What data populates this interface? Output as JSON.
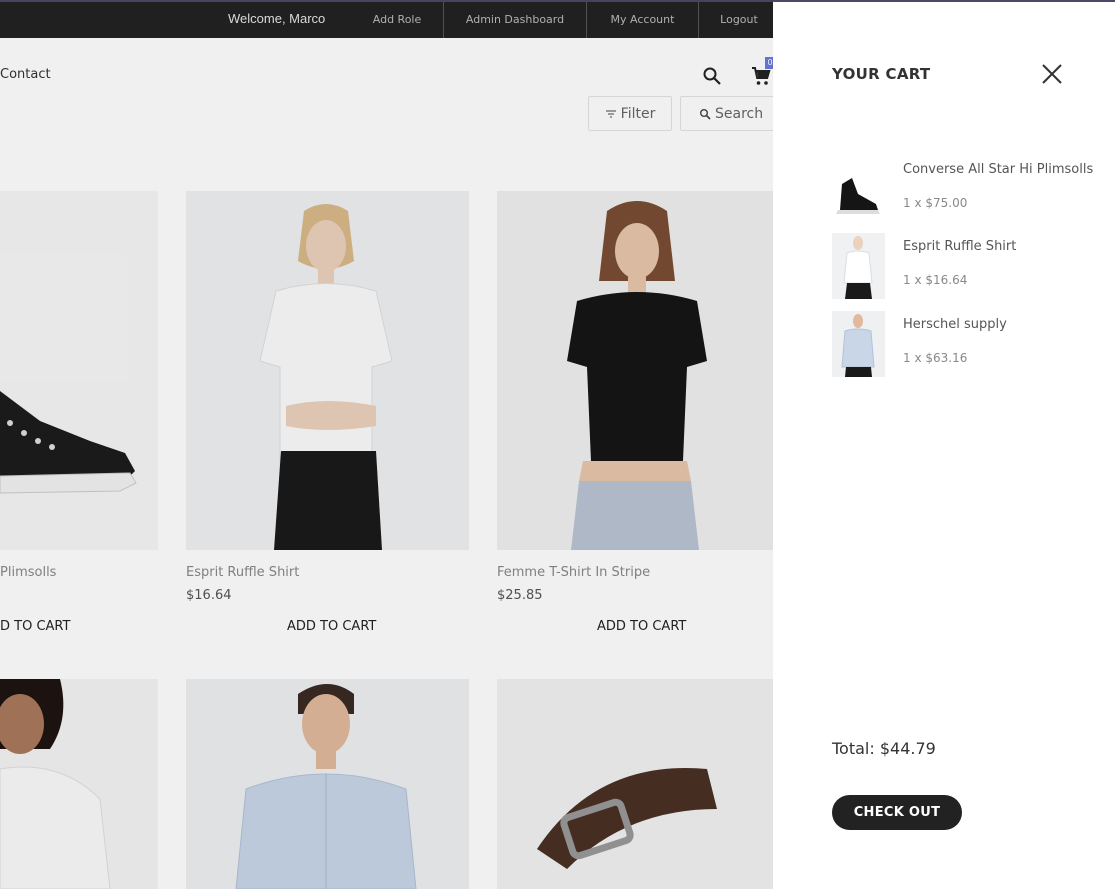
{
  "topbar": {
    "welcome": "Welcome, Marco",
    "links": [
      "Add Role",
      "Admin Dashboard",
      "My Account",
      "Logout"
    ]
  },
  "nav": {
    "contact": "Contact",
    "cart_count": "0"
  },
  "toolbar": {
    "filter_label": "Filter",
    "search_label": "Search"
  },
  "products": [
    {
      "name": "Converse All Star Hi Plimsolls",
      "visible_name": "Plimsolls",
      "price": "",
      "add_label": "ADD TO CART",
      "visible_add": "D TO CART"
    },
    {
      "name": "Esprit Ruffle Shirt",
      "price": "$16.64",
      "add_label": "ADD TO CART"
    },
    {
      "name": "Femme T-Shirt In Stripe",
      "price": "$25.85",
      "add_label": "ADD TO CART"
    }
  ],
  "cart": {
    "title": "YOUR CART",
    "items": [
      {
        "name": "Converse All Star Hi Plimsolls",
        "qty_price": "1 x $75.00"
      },
      {
        "name": "Esprit Ruffle Shirt",
        "qty_price": "1 x $16.64"
      },
      {
        "name": "Herschel supply",
        "qty_price": "1 x $63.16"
      }
    ],
    "total": "Total: $44.79",
    "checkout_label": "CHECK OUT"
  },
  "colors": {
    "topbar_bg": "#222222",
    "badge": "#6c7ae0",
    "checkout_bg": "#222222"
  }
}
